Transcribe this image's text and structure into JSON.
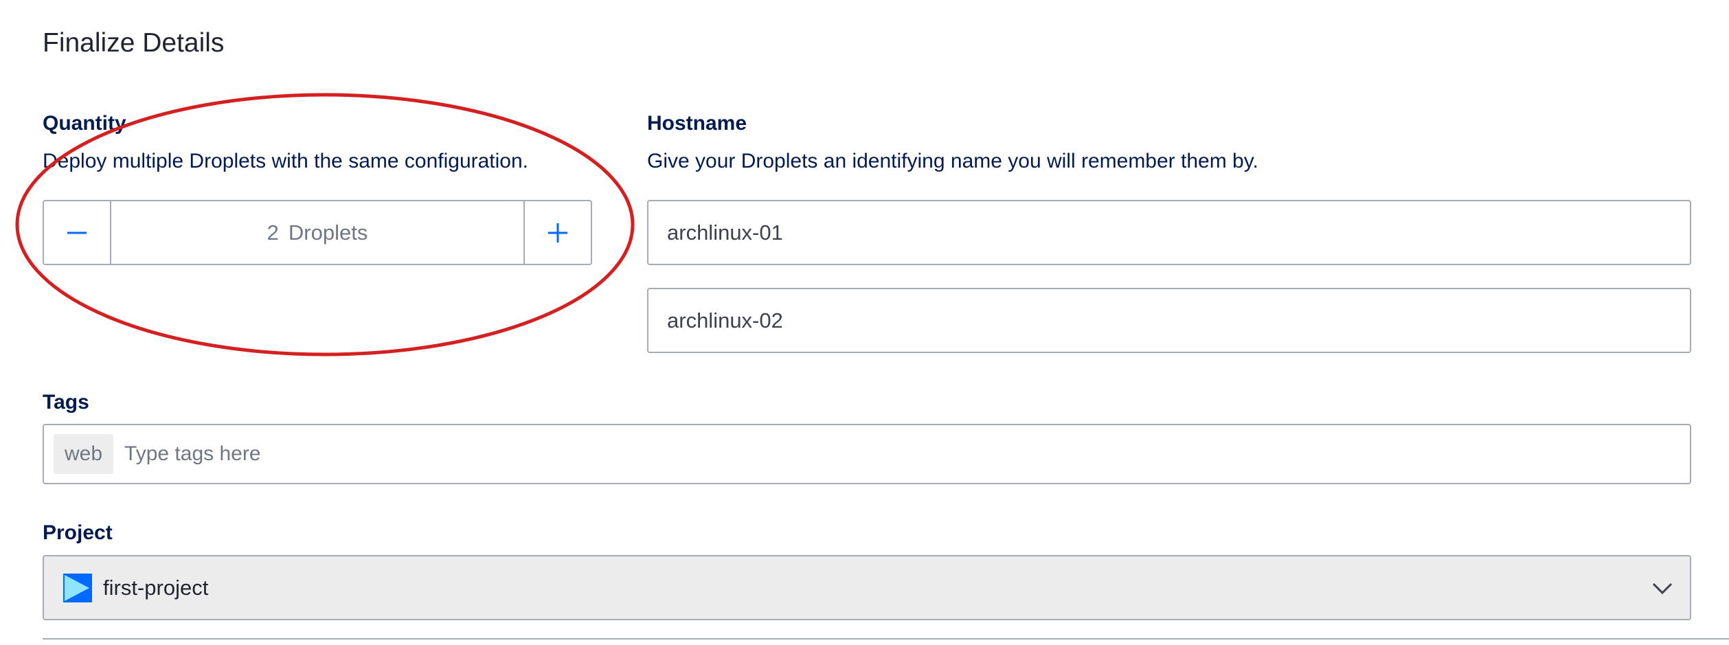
{
  "section": {
    "title": "Finalize Details"
  },
  "quantity": {
    "label": "Quantity",
    "description": "Deploy multiple Droplets with the same configuration.",
    "count": "2",
    "unit": "Droplets",
    "decrement_symbol": "minus-icon",
    "increment_symbol": "plus-icon"
  },
  "hostname": {
    "label": "Hostname",
    "description": "Give your Droplets an identifying name you will remember them by.",
    "inputs": [
      {
        "value": "archlinux-01"
      },
      {
        "value": "archlinux-02"
      }
    ]
  },
  "tags": {
    "label": "Tags",
    "chips": [
      "web"
    ],
    "placeholder": "Type tags here"
  },
  "project": {
    "label": "Project",
    "selected": "first-project",
    "icon": "project-icon",
    "dropdown_icon": "chevron-down-icon"
  },
  "colors": {
    "label_text": "#031b4e",
    "accent_blue": "#0069ff",
    "annotation_red": "#d42020",
    "border": "#a7abb3"
  }
}
